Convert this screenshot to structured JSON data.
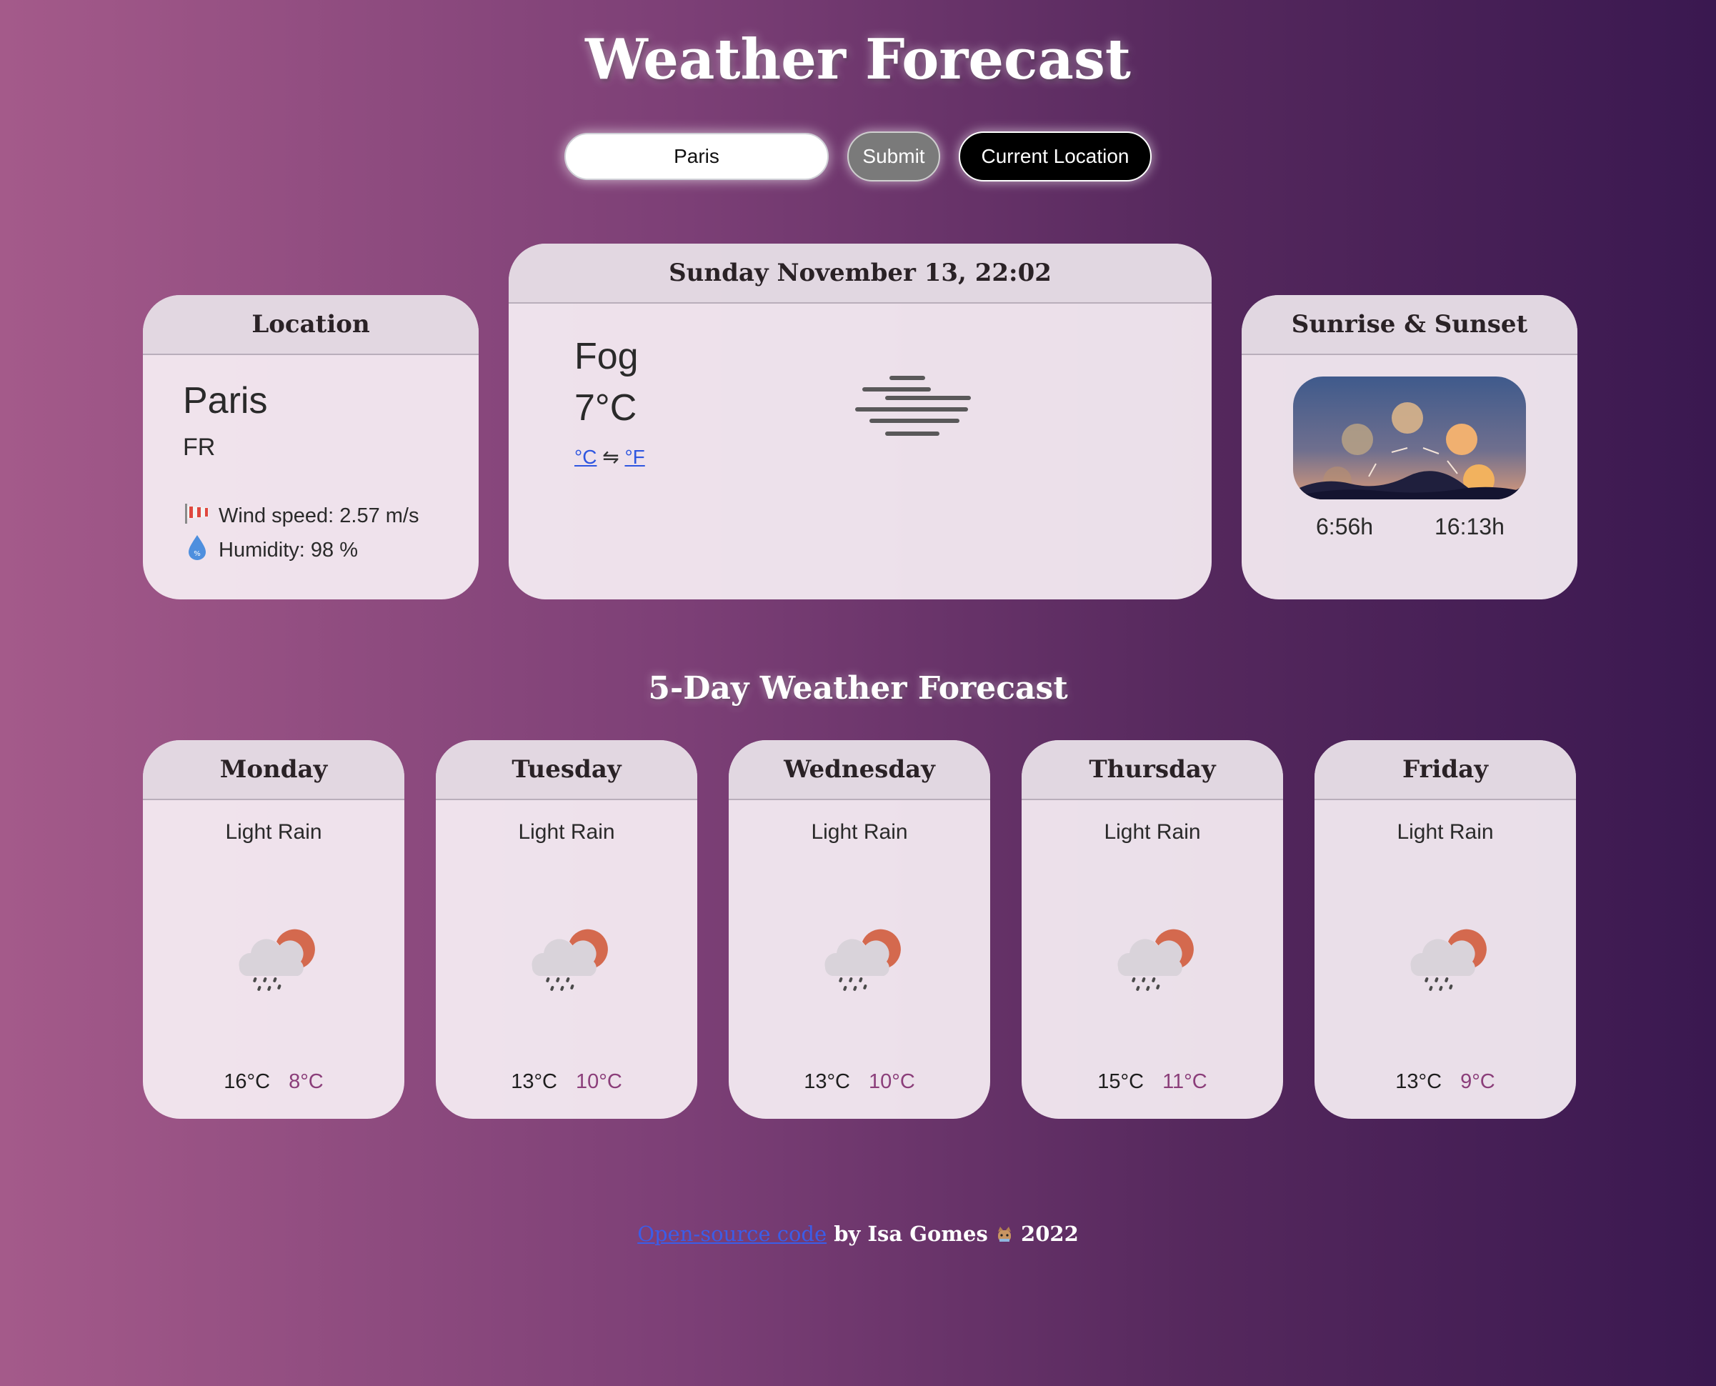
{
  "header": {
    "title": "Weather Forecast"
  },
  "search": {
    "value": "Paris",
    "submit_label": "Submit",
    "location_label": "Current Location"
  },
  "location_card": {
    "heading": "Location",
    "city": "Paris",
    "country": "FR",
    "wind": "Wind speed: 2.57 m/s",
    "humidity": "Humidity: 98 %",
    "wind_icon": "windsock-icon",
    "humidity_icon": "water-drop-icon"
  },
  "current": {
    "datetime": "Sunday November 13, 22:02",
    "description": "Fog",
    "temperature": "7°C",
    "unit_c": "°C",
    "unit_sep": "⇋",
    "unit_f": "°F",
    "icon": "fog-icon"
  },
  "sun_card": {
    "heading": "Sunrise & Sunset",
    "sunrise": "6:56h",
    "sunset": "16:13h",
    "image": "sun-path-illustration"
  },
  "forecast": {
    "title": "5-Day Weather Forecast",
    "days": [
      {
        "day": "Monday",
        "description": "Light Rain",
        "max": "16°C",
        "min": "8°C",
        "icon": "light-rain-icon"
      },
      {
        "day": "Tuesday",
        "description": "Light Rain",
        "max": "13°C",
        "min": "10°C",
        "icon": "light-rain-icon"
      },
      {
        "day": "Wednesday",
        "description": "Light Rain",
        "max": "13°C",
        "min": "10°C",
        "icon": "light-rain-icon"
      },
      {
        "day": "Thursday",
        "description": "Light Rain",
        "max": "15°C",
        "min": "11°C",
        "icon": "light-rain-icon"
      },
      {
        "day": "Friday",
        "description": "Light Rain",
        "max": "13°C",
        "min": "9°C",
        "icon": "light-rain-icon"
      }
    ]
  },
  "footer": {
    "link_text": "Open-source code",
    "author_text": "by Isa Gomes",
    "year": "2022"
  },
  "colors": {
    "gradient_start": "#a45a8a",
    "gradient_end": "#3a1850",
    "min_temp": "#8b3e7a",
    "link": "#3b5de8"
  }
}
